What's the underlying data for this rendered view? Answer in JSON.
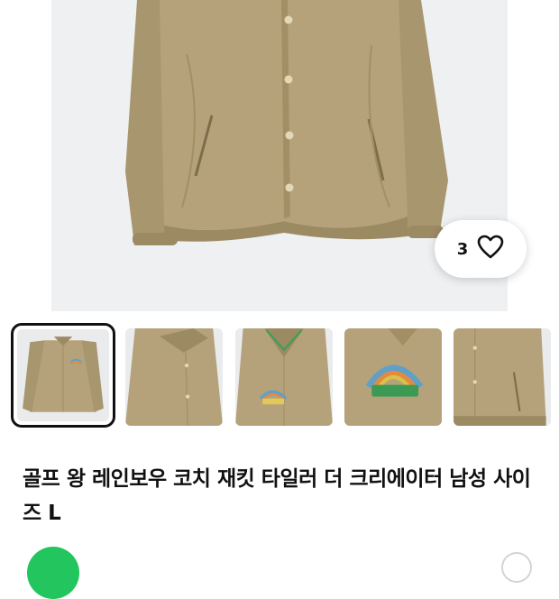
{
  "product": {
    "title": "골프 왕 레인보우 코치 재킷 타일러 더 크리에이터 남성 사이즈 L",
    "like_count": "3",
    "like_icon": "heart-outline-icon"
  },
  "gallery": {
    "main_image": "khaki-coach-jacket-photo",
    "thumbnails": [
      {
        "name": "thumb-front-full",
        "selected": true
      },
      {
        "name": "thumb-collar-detail",
        "selected": false
      },
      {
        "name": "thumb-front-logo",
        "selected": false
      },
      {
        "name": "thumb-logo-closeup",
        "selected": false
      },
      {
        "name": "thumb-pocket-detail",
        "selected": false
      }
    ]
  },
  "colors": {
    "jacket": "#b5a27a",
    "jacket_shadow": "#9c8a63",
    "background": "#eef0f2",
    "seller_avatar": "#22c55e"
  }
}
